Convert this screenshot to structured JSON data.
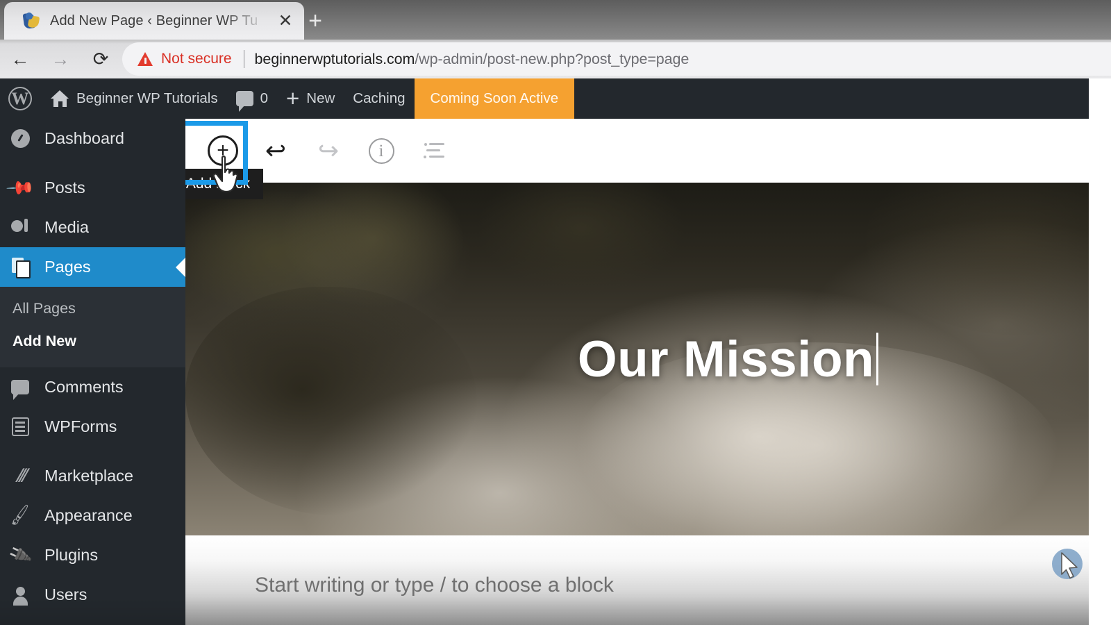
{
  "browser": {
    "tab": {
      "title": "Add New Page ‹ Beginner WP Tu",
      "favicon_name": "wordpress-site-favicon",
      "close_label": "✕"
    },
    "new_tab_label": "+",
    "nav": {
      "back_label": "←",
      "forward_label": "→",
      "reload_label": "⟳"
    },
    "omnibox": {
      "security_label": "Not secure",
      "url_host": "beginnerwptutorials.com",
      "url_path": "/wp-admin/post-new.php?post_type=page",
      "full_url": "beginnerwptutorials.com/wp-admin/post-new.php?post_type=page"
    }
  },
  "admin_bar": {
    "wp_logo_glyph": "W",
    "site_name": "Beginner WP Tutorials",
    "comments_count": "0",
    "new_label": "New",
    "caching_label": "Caching",
    "coming_soon_label": "Coming Soon Active",
    "coming_soon_color": "#f5a130",
    "background_color": "#23282d"
  },
  "sidebar": {
    "active_color": "#1f8bca",
    "items": [
      {
        "label": "Dashboard",
        "icon": "dashboard-icon",
        "active": false
      },
      {
        "label": "Posts",
        "icon": "pin-icon",
        "active": false
      },
      {
        "label": "Media",
        "icon": "media-icon",
        "active": false
      },
      {
        "label": "Pages",
        "icon": "pages-icon",
        "active": true
      },
      {
        "label": "Comments",
        "icon": "comment-icon",
        "active": false
      },
      {
        "label": "WPForms",
        "icon": "form-icon",
        "active": false
      },
      {
        "label": "Marketplace",
        "icon": "marketplace-icon",
        "active": false
      },
      {
        "label": "Appearance",
        "icon": "brush-icon",
        "active": false
      },
      {
        "label": "Plugins",
        "icon": "plug-icon",
        "active": false
      },
      {
        "label": "Users",
        "icon": "user-icon",
        "active": false
      }
    ],
    "submenu": [
      {
        "label": "All Pages",
        "current": false
      },
      {
        "label": "Add New",
        "current": true
      }
    ]
  },
  "editor": {
    "toolbar": {
      "add_block_label": "+",
      "add_block_tooltip": "Add block",
      "undo_label": "↩",
      "redo_label": "↪",
      "details_label": "i",
      "list_view_label": "list-view",
      "highlight_color": "#1b9ae8"
    },
    "hero": {
      "title": "Our Mission",
      "caret_visible": true
    },
    "paragraph": {
      "placeholder": "Start writing or type / to choose a block"
    }
  },
  "cursor": {
    "pointer_name": "mouse-pointer",
    "hand_name": "pointing-hand-cursor"
  }
}
